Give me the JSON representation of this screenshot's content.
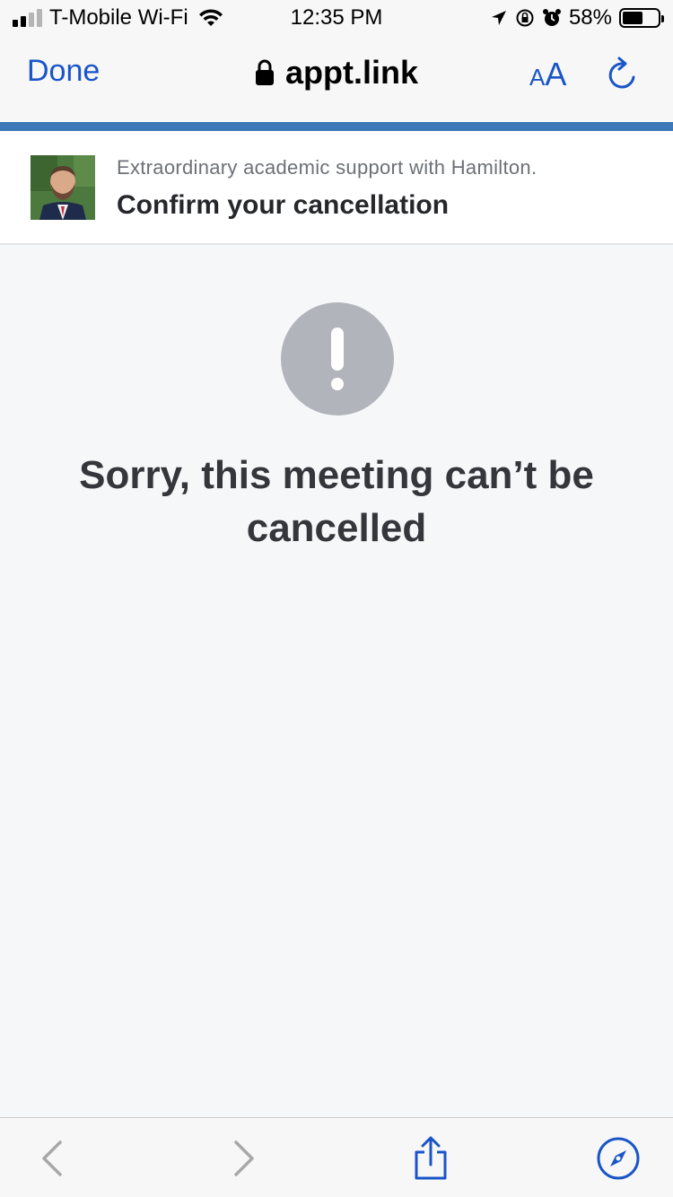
{
  "status_bar": {
    "carrier": "T-Mobile Wi-Fi",
    "time": "12:35 PM",
    "battery": "58%",
    "battery_level": 0.58
  },
  "browser": {
    "done_label": "Done",
    "url": "appt.link",
    "text_size_small": "A",
    "text_size_large": "A"
  },
  "page_header": {
    "subtitle": "Extraordinary academic support with Hamilton.",
    "title": "Confirm your cancellation"
  },
  "main": {
    "message": "Sorry, this meeting can’t be cancelled"
  },
  "colors": {
    "link_blue": "#1a55c8",
    "accent_bar": "#3f78b6",
    "alert_gray": "#b1b5bb",
    "text_dark": "#34363b"
  },
  "icons": {
    "status": [
      "signal-icon",
      "wifi-icon",
      "location-icon",
      "rotation-lock-icon",
      "alarm-icon",
      "battery-icon"
    ],
    "toolbar": [
      "back-icon",
      "forward-icon",
      "share-icon",
      "safari-compass-icon"
    ]
  }
}
